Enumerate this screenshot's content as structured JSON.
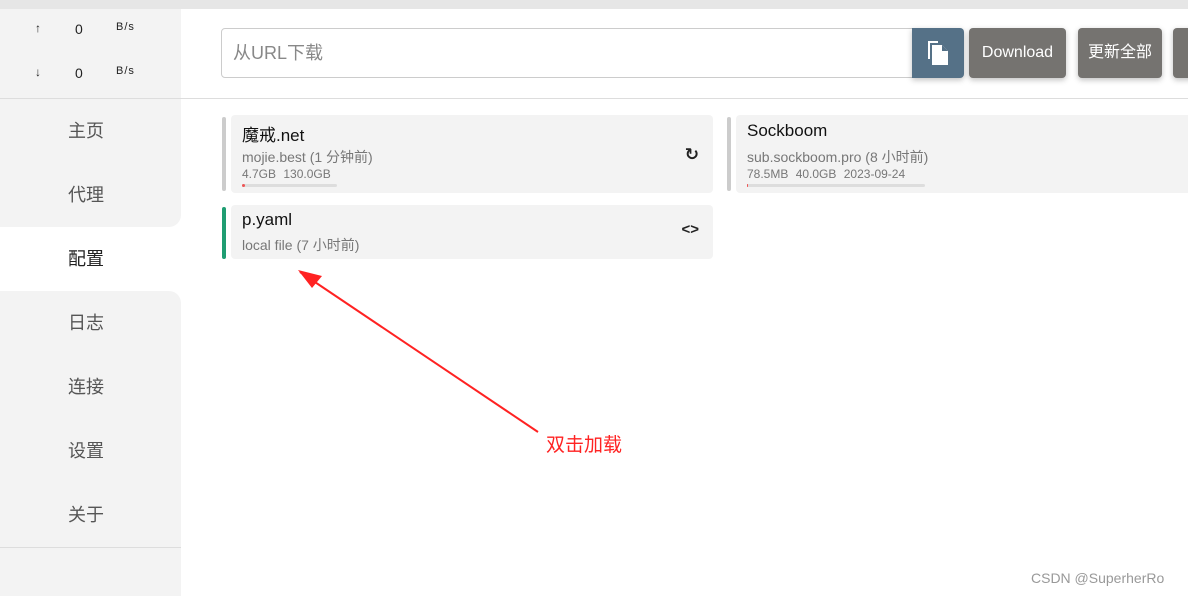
{
  "traffic": {
    "up": {
      "arrow": "↑",
      "value": "0",
      "unit": "B/s"
    },
    "down": {
      "arrow": "↓",
      "value": "0",
      "unit": "B/s"
    }
  },
  "nav": [
    {
      "label": "主页"
    },
    {
      "label": "代理"
    },
    {
      "label": "配置",
      "active": true
    },
    {
      "label": "日志"
    },
    {
      "label": "连接"
    },
    {
      "label": "设置"
    },
    {
      "label": "关于"
    }
  ],
  "toolbar": {
    "url_placeholder": "从URL下载",
    "copy_icon": "file-copy-icon",
    "download_label": "Download",
    "update_all_label": "更新全部"
  },
  "profiles": [
    {
      "title": "魔戒.net",
      "subtitle": "mojie.best (1 分钟前)",
      "used": "4.7GB",
      "total": "130.0GB",
      "usage_fraction": 0.036,
      "icon": "refresh-icon"
    },
    {
      "title": "Sockboom",
      "subtitle": "sub.sockboom.pro (8 小时前)",
      "used": "78.5MB",
      "total": "40.0GB",
      "expire": "2023-09-24",
      "usage_fraction": 0.002
    },
    {
      "title": "p.yaml",
      "subtitle": "local file (7 小时前)",
      "icon": "code-icon",
      "selected": true
    }
  ],
  "accent": "#1f9d72",
  "annotation": "双击加载",
  "watermark": "CSDN @SuperherRo"
}
